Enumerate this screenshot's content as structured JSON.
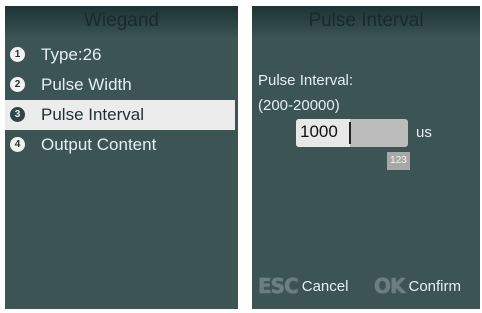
{
  "left_screen": {
    "title": "Wiegand",
    "items": [
      {
        "num": "1",
        "label": "Type:26"
      },
      {
        "num": "2",
        "label": "Pulse Width"
      },
      {
        "num": "3",
        "label": "Pulse Interval"
      },
      {
        "num": "4",
        "label": "Output Content"
      }
    ],
    "selected_index": 2
  },
  "right_screen": {
    "title": "Pulse Interval",
    "field_label": "Pulse Interval:",
    "range_text": "(200-20000)",
    "input_value": "1000",
    "unit": "us",
    "input_mode": "123",
    "softkeys": {
      "esc_glyph": "ESC",
      "esc_label": "Cancel",
      "ok_glyph": "OK",
      "ok_label": "Confirm"
    }
  },
  "colors": {
    "screen_bg": "#3c5454",
    "selected_bg": "#ececec",
    "text": "#e6efef"
  }
}
